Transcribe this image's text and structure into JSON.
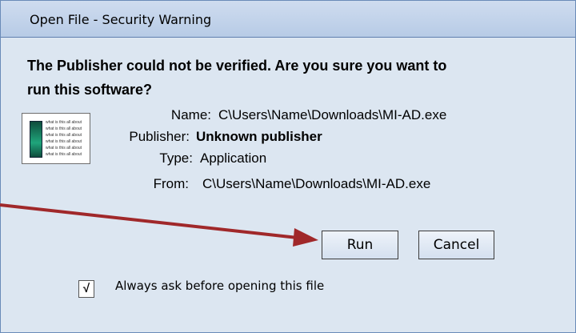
{
  "dialog": {
    "title": "Open File - Security Warning",
    "heading_line1": "The Publisher could not be verified. Are you sure you want to",
    "heading_line2": "run this software?",
    "icon_lines": [
      "what is this all about",
      "what is this all about",
      "what is this all about",
      "what is this all about",
      "what is this all about",
      "what is this all about"
    ],
    "fields": {
      "name_label": "Name:",
      "name_value": "C\\Users\\Name\\Downloads\\MI-AD.exe",
      "publisher_label": "Publisher:",
      "publisher_value": "Unknown publisher",
      "type_label": "Type:",
      "type_value": "Application",
      "from_label": "From:",
      "from_value": "C\\Users\\Name\\Downloads\\MI-AD.exe"
    },
    "buttons": {
      "run": "Run",
      "cancel": "Cancel"
    },
    "checkbox": {
      "mark": "√",
      "label": "Always ask before opening this file",
      "checked": true
    }
  },
  "annotation": {
    "arrow_color": "#a0282a",
    "icon": "arrow-pointing-to-run-button"
  }
}
